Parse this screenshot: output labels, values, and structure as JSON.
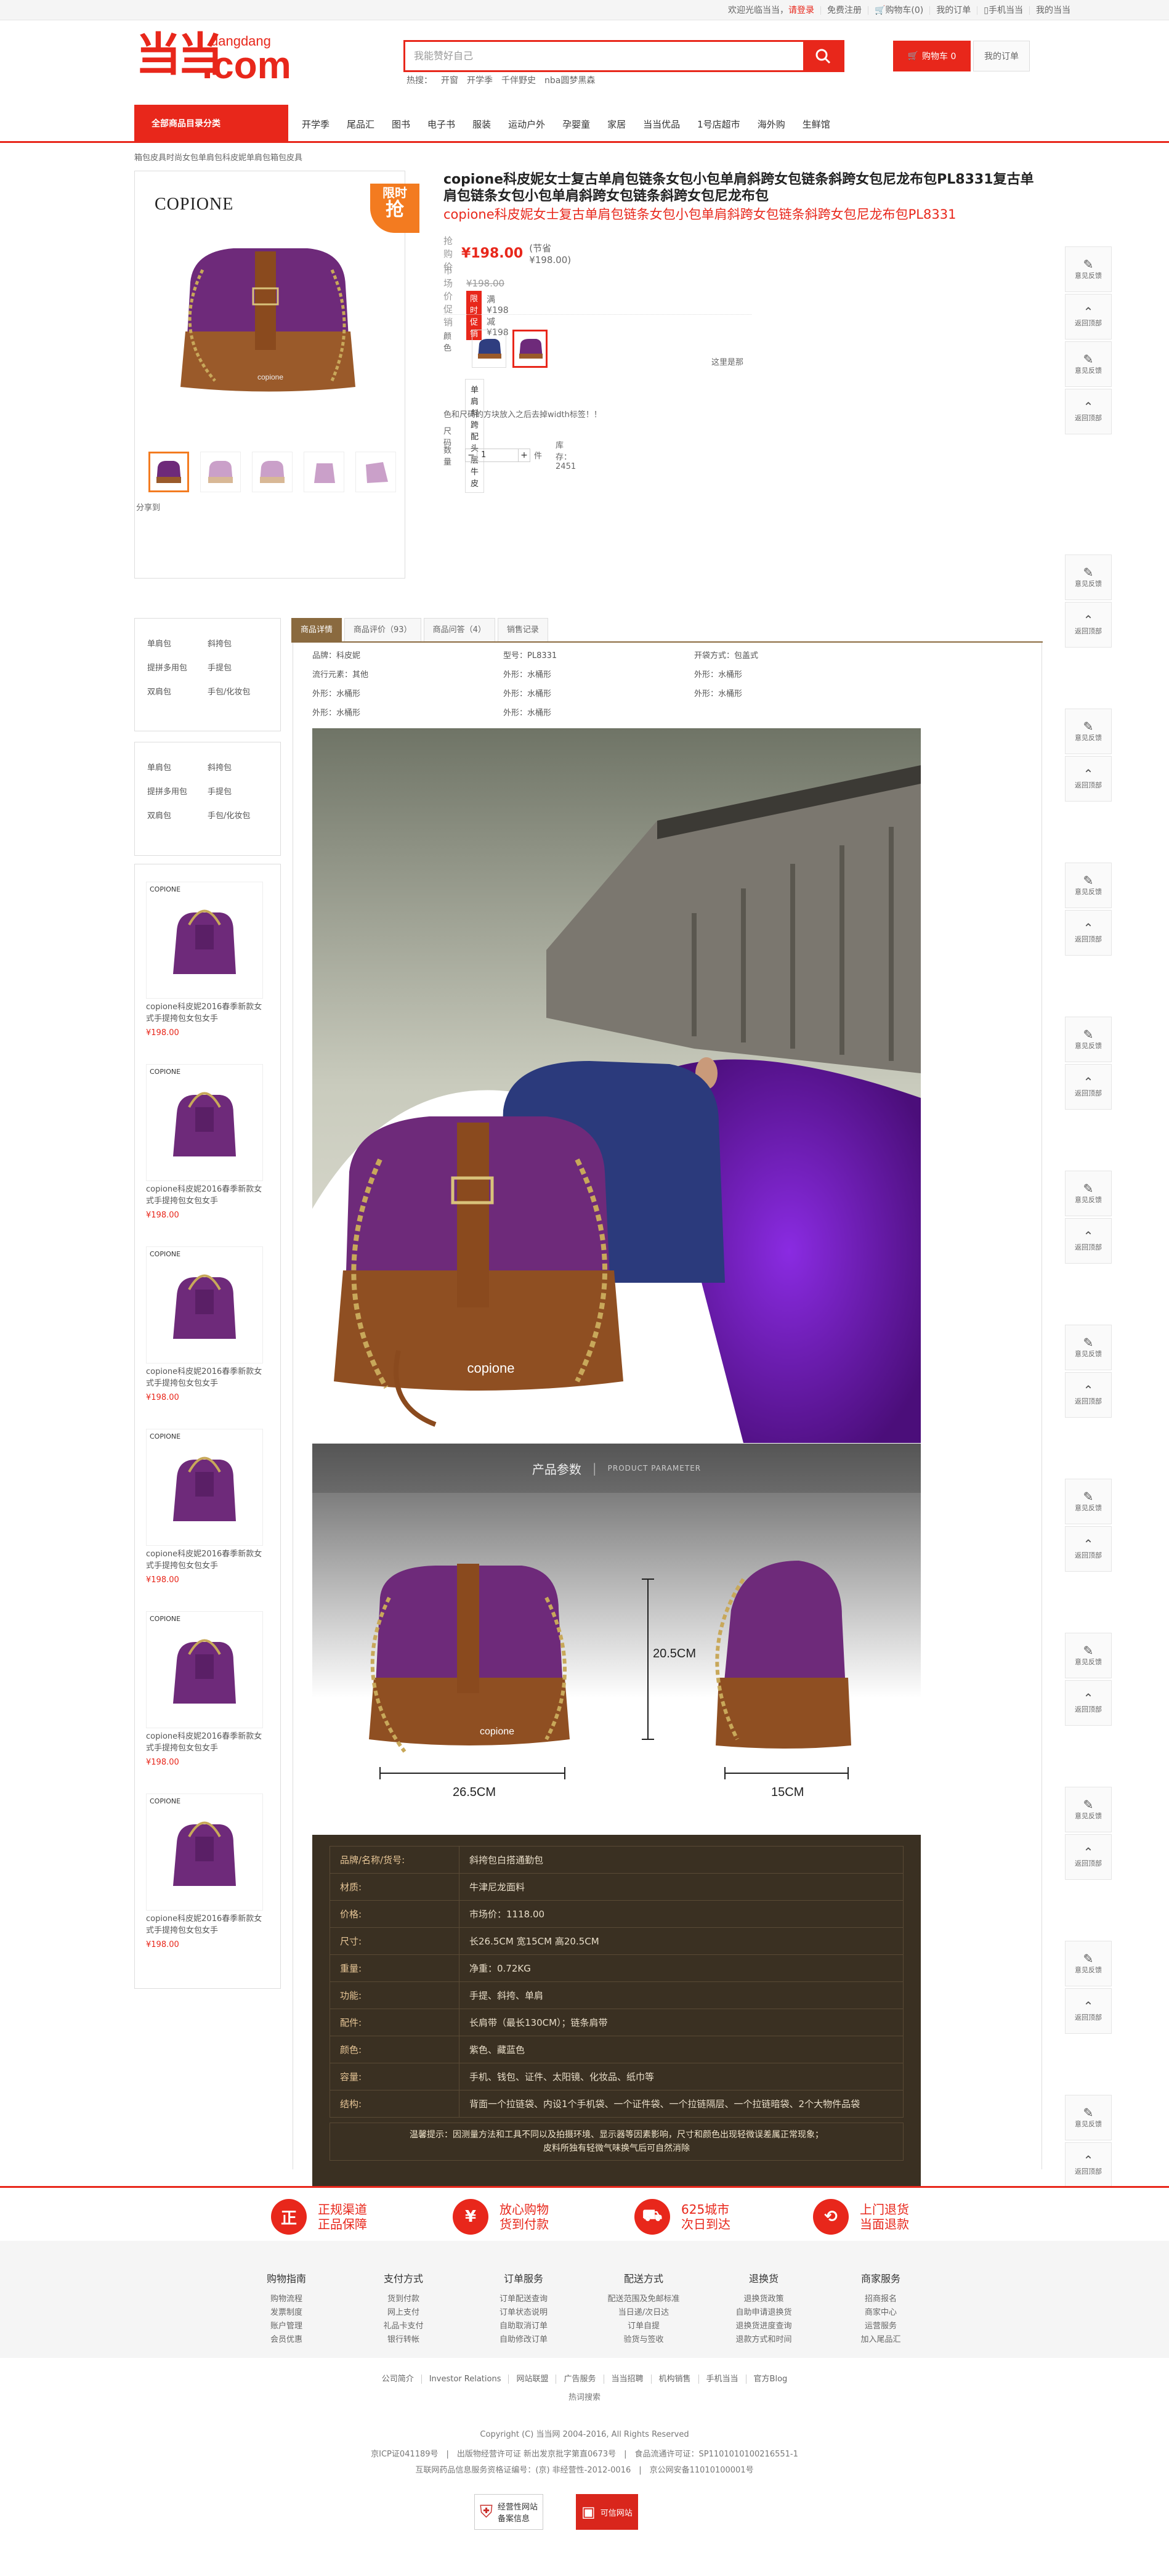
{
  "topbar": {
    "welcome": "欢迎光临当当，",
    "login": "请登录",
    "register": "免费注册",
    "cart": "购物车(0)",
    "orders": "我的订单",
    "mobile": "手机当当",
    "mydd": "我的当当"
  },
  "logo": {
    "cn": "当当",
    "en": "dangdang",
    "com": ".com"
  },
  "search": {
    "placeholder": "我能赞好自己",
    "hot_label": "热搜：",
    "hot": [
      "开窗",
      "开学季",
      "千伴野史",
      "nba圆梦黑森"
    ]
  },
  "cart": {
    "label": "购物车 0",
    "orders": "我的订单"
  },
  "nav": {
    "all": "全部商品目录分类",
    "items": [
      "开学季",
      "尾品汇",
      "图书",
      "电子书",
      "服装",
      "运动户外",
      "孕婴童",
      "家居",
      "当当优品",
      "1号店超市",
      "海外购",
      "生鲜馆"
    ]
  },
  "breadcrumb": "箱包皮具时尚女包单肩包科皮妮单肩包箱包皮具",
  "gallery": {
    "brand": "COPIONE",
    "badge_1": "限时",
    "badge_2": "抢",
    "share": "分享到"
  },
  "product": {
    "title": "copione科皮妮女士复古单肩包链条女包小包单肩斜跨女包链条斜跨女包尼龙布包PL8331复古单肩包链条女包小包单肩斜跨女包链条斜跨女包尼龙布包",
    "subtitle": "copione科皮妮女士复古单肩包链条女包小包单肩斜跨女包链条斜跨女包尼龙布包PL8331",
    "price_label": "抢购价",
    "price": "¥198.00",
    "save": "(节省¥198.00)",
    "market_label": "市场价",
    "market_price": "¥198.00",
    "promo_label": "促销",
    "promo_tag": "限时促销",
    "promo_text": "满¥198减¥198",
    "color_label": "颜色",
    "color_note": "这里是那",
    "size_label": "尺码",
    "size_value": "单肩斜跨配头层牛皮",
    "note": "色和尺码的方块放入之后去掉width标签！！",
    "qty_label": "数量",
    "qty_minus": "−",
    "qty": "1",
    "qty_plus": "+",
    "qty_unit": "件",
    "stock": "库存：2451"
  },
  "rightbar": {
    "feedback": "意见反馈",
    "top": "返回顶部"
  },
  "sidecats": [
    "单肩包",
    "斜挎包",
    "提拼多用包",
    "手提包",
    "双肩包",
    "手包/化妆包"
  ],
  "sideproducts": [
    {
      "brand": "COPIONE",
      "name": "copione科皮妮2016春季新款女式手提挎包女包女手",
      "price": "¥198.00"
    },
    {
      "brand": "COPIONE",
      "name": "copione科皮妮2016春季新款女式手提挎包女包女手",
      "price": "¥198.00"
    },
    {
      "brand": "COPIONE",
      "name": "copione科皮妮2016春季新款女式手提挎包女包女手",
      "price": "¥198.00"
    },
    {
      "brand": "COPIONE",
      "name": "copione科皮妮2016春季新款女式手提挎包女包女手",
      "price": "¥198.00"
    },
    {
      "brand": "COPIONE",
      "name": "copione科皮妮2016春季新款女式手提挎包女包女手",
      "price": "¥198.00"
    },
    {
      "brand": "COPIONE",
      "name": "copione科皮妮2016春季新款女式手提挎包女包女手",
      "price": "¥198.00"
    }
  ],
  "tabs": [
    "商品详情",
    "商品评价（93）",
    "商品问答（4）",
    "销售记录"
  ],
  "attrs": [
    "品牌：科皮妮",
    "型号：PL8331",
    "开袋方式：包盖式",
    "流行元素：其他",
    "外形：水桶形",
    "外形：水桶形",
    "外形：水桶形",
    "外形：水桶形",
    "外形：水桶形",
    "外形：水桶形",
    "外形：水桶形"
  ],
  "param": {
    "title": "产品参数",
    "title_en": "PRODUCT PARAMETER",
    "brand_on_bag": "copione",
    "h": "20.5CM",
    "w": "26.5CM",
    "d": "15CM"
  },
  "spec": [
    {
      "k": "品牌/名称/货号:",
      "v": "斜挎包白搭通勤包"
    },
    {
      "k": "材质:",
      "v": "牛津尼龙面料"
    },
    {
      "k": "价格:",
      "v": "市场价：1118.00"
    },
    {
      "k": "尺寸:",
      "v": "长26.5CM 宽15CM 高20.5CM"
    },
    {
      "k": "重量:",
      "v": "净重：0.72KG"
    },
    {
      "k": "功能:",
      "v": "手提、斜挎、单肩"
    },
    {
      "k": "配件:",
      "v": "长肩带（最长130CM）；链条肩带"
    },
    {
      "k": "颜色:",
      "v": "紫色、藏蓝色"
    },
    {
      "k": "容量:",
      "v": "手机、钱包、证件、太阳镜、化妆品、纸巾等"
    },
    {
      "k": "结构:",
      "v": "背面一个拉链袋、内设1个手机袋、一个证件袋、一个拉链隔层、一个拉链暗袋、2个大物件品袋"
    }
  ],
  "spec_note_1": "温馨提示：因测量方法和工具不同以及拍摄环境、显示器等因素影响，尺寸和颜色出现轻微误差属正常现象；",
  "spec_note_2": "皮料所独有轻微气味换气后可自然消除",
  "services": [
    {
      "icon": "正",
      "t1": "正规渠道",
      "t2": "正品保障"
    },
    {
      "icon": "¥",
      "t1": "放心购物",
      "t2": "货到付款"
    },
    {
      "icon": "⛟",
      "t1": "625城市",
      "t2": "次日到达"
    },
    {
      "icon": "⟲",
      "t1": "上门退货",
      "t2": "当面退款"
    }
  ],
  "footcols": [
    {
      "h": "购物指南",
      "items": [
        "购物流程",
        "发票制度",
        "账户管理",
        "会员优惠"
      ]
    },
    {
      "h": "支付方式",
      "items": [
        "货到付款",
        "网上支付",
        "礼品卡支付",
        "银行转帐"
      ]
    },
    {
      "h": "订单服务",
      "items": [
        "订单配送查询",
        "订单状态说明",
        "自助取消订单",
        "自助修改订单"
      ]
    },
    {
      "h": "配送方式",
      "items": [
        "配送范围及免邮标准",
        "当日递/次日达",
        "订单自提",
        "验货与签收"
      ]
    },
    {
      "h": "退换货",
      "items": [
        "退换货政策",
        "自助申请退换货",
        "退换货进度查询",
        "退款方式和时间"
      ]
    },
    {
      "h": "商家服务",
      "items": [
        "招商报名",
        "商家中心",
        "运营服务",
        "加入尾品汇"
      ]
    }
  ],
  "footlinks": [
    "公司简介",
    "Investor Relations",
    "网站联盟",
    "广告服务",
    "当当招聘",
    "机构销售",
    "手机当当",
    "官方Blog"
  ],
  "footlinks2": "热词搜索",
  "copyright": "Copyright (C) 当当网 2004-2016, All Rights Reserved",
  "icp": "京ICP证041189号　|　出版物经营许可证 新出发京批字第直0673号　|　食品流通许可证：SP1101010100216551-1",
  "icp2": "互联网药品信息服务资格证编号：(京) 非经营性-2012-0016　|　京公网安备11010100001号",
  "badges": [
    {
      "t1": "经营性网站",
      "t2": "备案信息"
    },
    {
      "t": "可信网站"
    }
  ]
}
